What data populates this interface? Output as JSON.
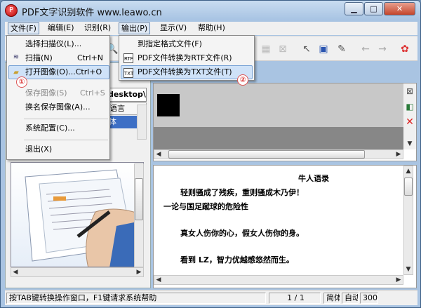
{
  "window": {
    "title": "PDF文字识别软件 www.leawo.cn"
  },
  "title_buttons": {
    "minimize": "▁",
    "maximize": "□",
    "close": "✕"
  },
  "menubar": {
    "file": "文件(F)",
    "edit": "编辑(E)",
    "recognize": "识别(R)",
    "output": "输出(P)",
    "view": "显示(V)",
    "help": "帮助(H)"
  },
  "file_menu": {
    "items": [
      {
        "label": "选择扫描仪(L)...",
        "shortcut": ""
      },
      {
        "label": "扫描(N)",
        "shortcut": "Ctrl+N"
      },
      {
        "label": "打开图像(O)...Ctrl+O",
        "shortcut": ""
      },
      {
        "label": "保存图像(S)",
        "shortcut": "Ctrl+S"
      },
      {
        "label": "换名保存图像(A)...",
        "shortcut": ""
      },
      {
        "label": "系统配置(C)...",
        "shortcut": ""
      },
      {
        "label": "退出(X)",
        "shortcut": ""
      }
    ],
    "badge": "①"
  },
  "output_menu": {
    "items": [
      {
        "label": "到指定格式文件(F)"
      },
      {
        "label": "PDF文件转换为RTF文件(R)"
      },
      {
        "label": "PDF文件转换为TXT文件(T)"
      }
    ],
    "badge": "②"
  },
  "left_panel": {
    "path_text": "desktop\\",
    "lang_header": "语言",
    "lang_selected": "体"
  },
  "document_text": {
    "title": "牛人语录",
    "lines": [
      "轻则骚成了残疾，重则骚成木乃伊！",
      "一论与国足蹴球的危险性",
      "真女人伤你的心，假女人伤你的身。",
      "看到 LZ，智力优越感悠然而生。"
    ]
  },
  "statusbar": {
    "help_text": "按TAB键转换操作窗口，F1键请求系统帮助",
    "page": "1  /  1",
    "s1": "简体",
    "s2": "自动",
    "s3": "300"
  },
  "colors": {
    "highlight_blue": "#3d6fc5",
    "badge_red": "#d44444",
    "title_gradient_top": "#c9dcf0"
  }
}
